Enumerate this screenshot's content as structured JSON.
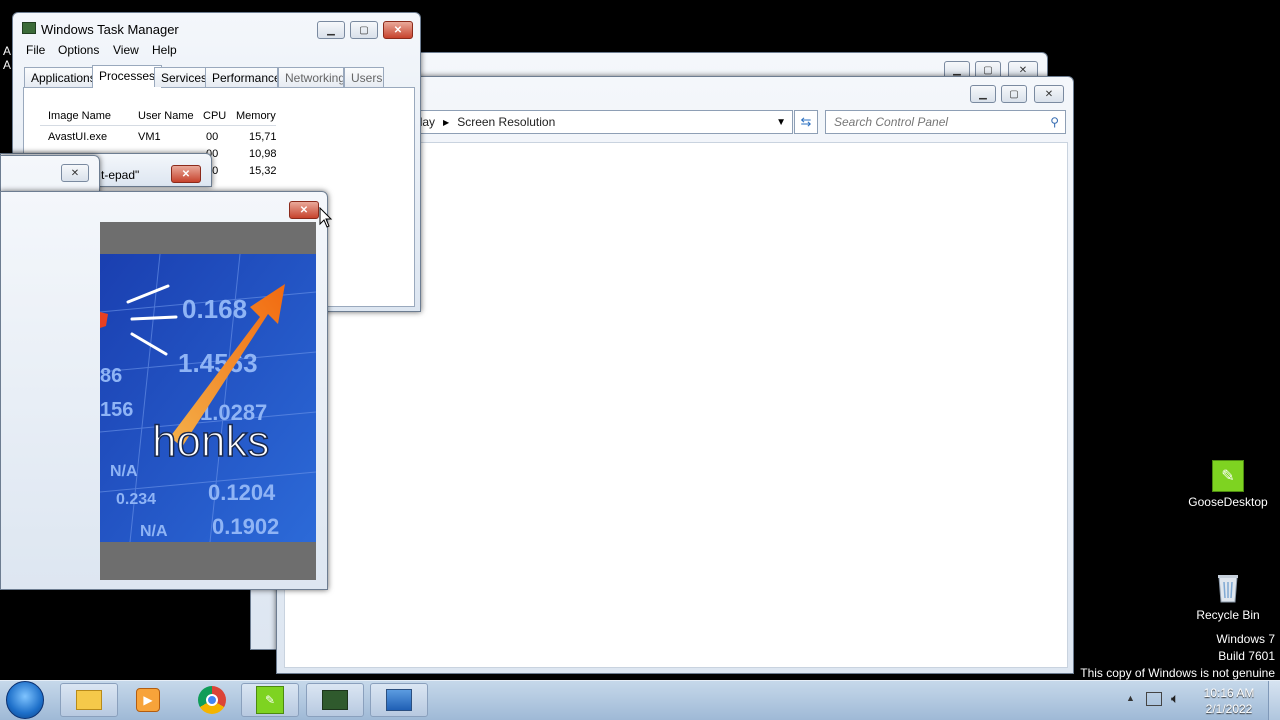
{
  "task_manager": {
    "title": "Windows Task Manager",
    "menu": [
      "File",
      "Options",
      "View",
      "Help"
    ],
    "tabs": [
      "Applications",
      "Processes",
      "Services",
      "Performance",
      "Networking",
      "Users"
    ],
    "active_tab": "Processes",
    "columns": [
      "Image Name",
      "User Name",
      "CPU",
      "Memory"
    ],
    "rows": [
      {
        "image": "AvastUI.exe",
        "user": "VM1",
        "cpu": "00",
        "mem": "15,71"
      },
      {
        "image": "",
        "user": "",
        "cpu": "00",
        "mem": "10,98"
      },
      {
        "image": "",
        "user": "",
        "cpu": "00",
        "mem": "15,32"
      }
    ]
  },
  "notepad_fragment": {
    "title_text": "t-epad\""
  },
  "meme_window": {
    "caption_text": "honks",
    "numbers": [
      "0.168",
      "1.4563",
      "1.0287",
      "0.1204",
      "0.1902",
      "0.234",
      "N/A",
      "156",
      "86",
      "N/A"
    ]
  },
  "control_panel": {
    "breadcrumb_prefix": "«",
    "breadcrumb": [
      "Display",
      "Screen Resolution"
    ],
    "search_placeholder": "Search Control Panel"
  },
  "desktop": {
    "icons": [
      {
        "label": "GooseDesktop",
        "icon": "goose-icon"
      },
      {
        "label": "Recycle Bin",
        "icon": "recycle-bin-icon"
      }
    ],
    "watermark": [
      "Windows 7",
      "Build 7601",
      "This copy of Windows is not genuine"
    ]
  },
  "taskbar": {
    "time": "10:16 AM",
    "date": "2/1/2022",
    "buttons": [
      "start-orb",
      "explorer",
      "media-player",
      "chrome",
      "goose",
      "task-manager",
      "control-panel"
    ]
  },
  "colors": {
    "taskbar": "#a9c2dc",
    "meme_blue": "#1d4fb8",
    "arrow_orange": "#f08a1c",
    "desktop": "#000000"
  }
}
